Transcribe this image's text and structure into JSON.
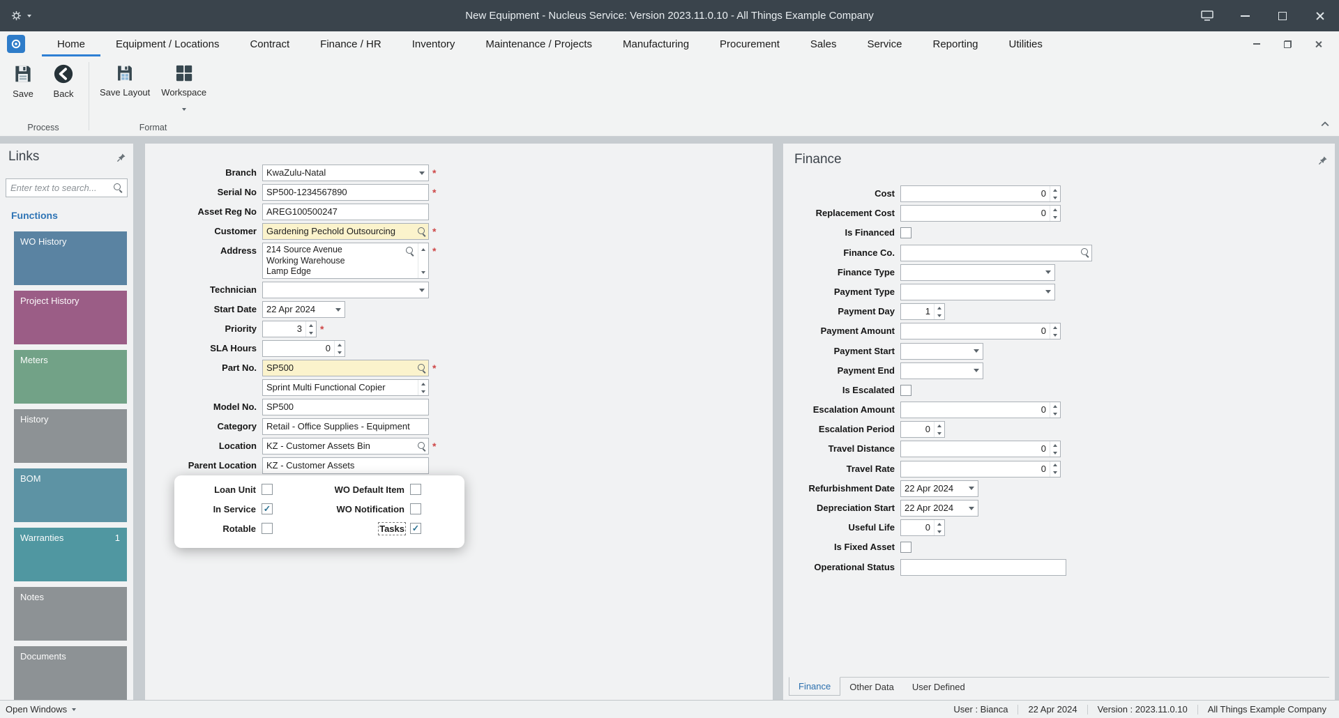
{
  "titlebar": {
    "title": "New Equipment - Nucleus Service: Version 2023.11.0.10 - All Things Example Company"
  },
  "ribbon": {
    "tabs": [
      {
        "label": "Home",
        "active": true
      },
      {
        "label": "Equipment / Locations"
      },
      {
        "label": "Contract"
      },
      {
        "label": "Finance / HR"
      },
      {
        "label": "Inventory"
      },
      {
        "label": "Maintenance / Projects"
      },
      {
        "label": "Manufacturing"
      },
      {
        "label": "Procurement"
      },
      {
        "label": "Sales"
      },
      {
        "label": "Service"
      },
      {
        "label": "Reporting"
      },
      {
        "label": "Utilities"
      }
    ],
    "toolbar_groups": [
      {
        "label": "Process",
        "buttons": [
          {
            "label": "Save",
            "icon": "save-icon"
          },
          {
            "label": "Back",
            "icon": "back-icon"
          }
        ]
      },
      {
        "label": "Format",
        "buttons": [
          {
            "label": "Save Layout",
            "icon": "save-layout-icon"
          },
          {
            "label": "Workspace",
            "icon": "workspace-icon",
            "caret": true
          }
        ]
      }
    ]
  },
  "links_panel": {
    "title": "Links",
    "search_placeholder": "Enter text to search...",
    "section_label": "Functions",
    "items": [
      {
        "label": "WO History",
        "color": "#5a83a2"
      },
      {
        "label": "Project History",
        "color": "#9b5d86"
      },
      {
        "label": "Meters",
        "color": "#72a287"
      },
      {
        "label": "History",
        "color": "#8d9295"
      },
      {
        "label": "BOM",
        "color": "#5d93a4"
      },
      {
        "label": "Warranties",
        "color": "#5097a1",
        "badge": "1"
      },
      {
        "label": "Notes",
        "color": "#8d9295"
      },
      {
        "label": "Documents",
        "color": "#8d9295"
      }
    ]
  },
  "form": {
    "rows": [
      {
        "label": "Branch",
        "value": "KwaZulu-Natal",
        "type": "dropdown",
        "size": "std",
        "required": true
      },
      {
        "label": "Serial No",
        "value": "SP500-1234567890",
        "type": "text",
        "size": "std",
        "required": true
      },
      {
        "label": "Asset Reg No",
        "value": "AREG100500247",
        "type": "text",
        "size": "std"
      },
      {
        "label": "Customer",
        "value": "Gardening Pechold Outsourcing",
        "type": "search",
        "size": "std",
        "required": true,
        "highlight": true
      },
      {
        "label": "Address",
        "value": "214 Source Avenue\nWorking Warehouse\nLamp Edge",
        "type": "address",
        "size": "std",
        "required": true
      },
      {
        "label": "Technician",
        "value": "",
        "type": "dropdown",
        "size": "std"
      },
      {
        "label": "Start Date",
        "value": "22 Apr 2024",
        "type": "dropdown",
        "size": "date"
      },
      {
        "label": "Priority",
        "value": "3",
        "type": "spinner",
        "size": "pri",
        "required": true
      },
      {
        "label": "SLA Hours",
        "value": "0",
        "type": "spinner",
        "size": "date"
      },
      {
        "label": "Part No.",
        "value": "SP500",
        "type": "search",
        "size": "std",
        "required": true,
        "highlight": true
      },
      {
        "label": "",
        "name": "part-description",
        "value": "Sprint Multi Functional Copier",
        "type": "textspin",
        "size": "std"
      },
      {
        "label": "Model No.",
        "value": "SP500",
        "type": "text",
        "size": "std"
      },
      {
        "label": "Category",
        "value": "Retail - Office Supplies - Equipment",
        "type": "text",
        "size": "std"
      },
      {
        "label": "Location",
        "value": "KZ - Customer Assets Bin",
        "type": "search",
        "size": "std",
        "required": true
      },
      {
        "label": "Parent Location",
        "value": "KZ - Customer Assets",
        "type": "text",
        "size": "std"
      }
    ],
    "checkboxes": [
      {
        "label": "Loan Unit",
        "checked": false
      },
      {
        "label": "WO Default Item",
        "checked": false
      },
      {
        "label": "In Service",
        "checked": true
      },
      {
        "label": "WO Notification",
        "checked": false
      },
      {
        "label": "Rotable",
        "checked": false
      },
      {
        "label": "Tasks",
        "checked": true,
        "focused": true
      }
    ]
  },
  "finance_panel": {
    "title": "Finance",
    "rows": [
      {
        "label": "Cost",
        "value": "0",
        "type": "spinner",
        "size": "fin"
      },
      {
        "label": "Replacement Cost",
        "value": "0",
        "type": "spinner",
        "size": "fin"
      },
      {
        "label": "Is Financed",
        "type": "checkbox",
        "checked": false
      },
      {
        "label": "Finance Co.",
        "value": "",
        "type": "search",
        "size": "finco"
      },
      {
        "label": "Finance Type",
        "value": "",
        "type": "dropdown",
        "size": "findd"
      },
      {
        "label": "Payment Type",
        "value": "",
        "type": "dropdown",
        "size": "findd"
      },
      {
        "label": "Payment Day",
        "value": "1",
        "type": "spinner",
        "size": "tiny"
      },
      {
        "label": "Payment Amount",
        "value": "0",
        "type": "spinner",
        "size": "fin"
      },
      {
        "label": "Payment Start",
        "value": "",
        "type": "dropdown",
        "size": "date"
      },
      {
        "label": "Payment End",
        "value": "",
        "type": "dropdown",
        "size": "date"
      },
      {
        "label": "Is Escalated",
        "type": "checkbox",
        "checked": false
      },
      {
        "label": "Escalation Amount",
        "value": "0",
        "type": "spinner",
        "size": "fin"
      },
      {
        "label": "Escalation Period",
        "value": "0",
        "type": "spinner",
        "size": "tiny"
      },
      {
        "label": "Travel Distance",
        "value": "0",
        "type": "spinner",
        "size": "fin"
      },
      {
        "label": "Travel Rate",
        "value": "0",
        "type": "spinner",
        "size": "fin"
      },
      {
        "label": "Refurbishment Date",
        "value": "22 Apr 2024",
        "type": "dropdown",
        "size": "findate"
      },
      {
        "label": "Depreciation Start",
        "value": "22 Apr 2024",
        "type": "dropdown",
        "size": "findate"
      },
      {
        "label": "Useful Life",
        "value": "0",
        "type": "spinner",
        "size": "tiny"
      },
      {
        "label": "Is Fixed Asset",
        "type": "checkbox",
        "checked": false
      },
      {
        "label": "Operational Status",
        "value": "",
        "type": "text",
        "size": "finstatus"
      }
    ],
    "tabs": [
      {
        "label": "Finance",
        "active": true
      },
      {
        "label": "Other Data"
      },
      {
        "label": "User Defined"
      }
    ]
  },
  "statusbar": {
    "open_windows_label": "Open Windows",
    "items": [
      {
        "id": "user",
        "text": "User : Bianca"
      },
      {
        "id": "date",
        "text": "22 Apr 2024"
      },
      {
        "id": "version",
        "text": "Version : 2023.11.0.10"
      },
      {
        "id": "company",
        "text": "All Things Example Company"
      }
    ]
  }
}
